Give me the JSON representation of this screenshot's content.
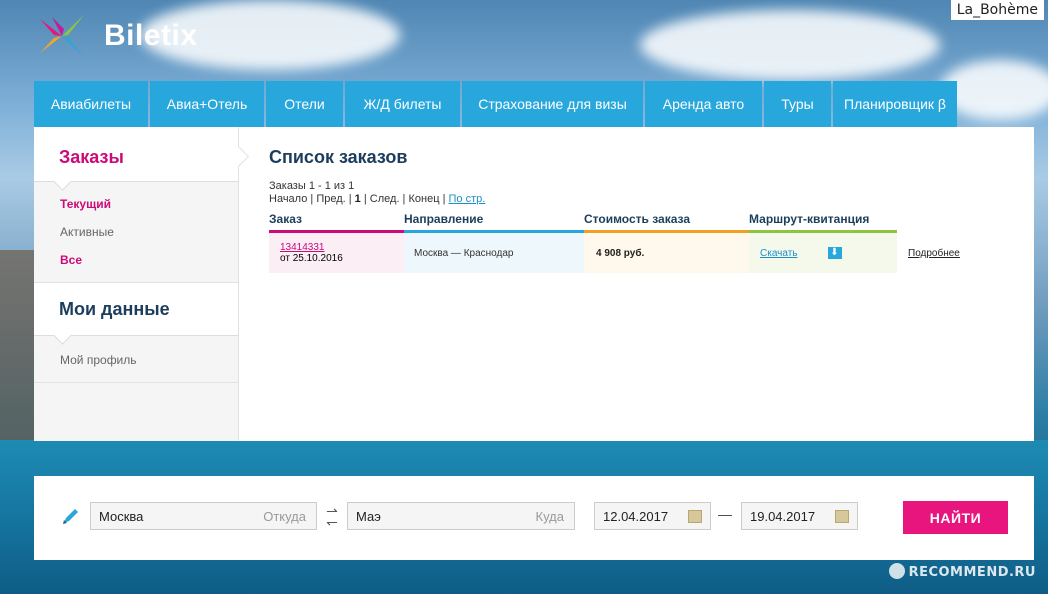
{
  "watermarks": {
    "user": "La_Bohème",
    "site": "RECOMMEND.RU"
  },
  "logo": {
    "text": "Biletix"
  },
  "nav": [
    {
      "label": "Авиабилеты"
    },
    {
      "label": "Авиа+Отель"
    },
    {
      "label": "Отели"
    },
    {
      "label": "Ж/Д билеты"
    },
    {
      "label": "Страхование для визы"
    },
    {
      "label": "Аренда авто"
    },
    {
      "label": "Туры"
    },
    {
      "label": "Планировщик β"
    }
  ],
  "sidebar": {
    "orders_title": "Заказы",
    "orders_links": [
      "Текущий",
      "Активные",
      "Все"
    ],
    "mydata_title": "Мои данные",
    "profile_link": "Мой профиль"
  },
  "content": {
    "title": "Список заказов",
    "pager_summary": "Заказы 1 - 1 из 1",
    "pager": {
      "start": "Начало",
      "prev": "Пред.",
      "current": "1",
      "next": "След.",
      "end": "Конец",
      "per_page": "По стр."
    },
    "columns": [
      "Заказ",
      "Направление",
      "Стоимость заказа",
      "Маршрут-квитанция"
    ],
    "rows": [
      {
        "order_id": "13414331",
        "order_date": "от 25.10.2016",
        "route": "Москва — Краснодар",
        "price": "4 908 руб.",
        "download": "Скачать",
        "details": "Подробнее"
      }
    ]
  },
  "search": {
    "from_value": "Москва",
    "from_placeholder": "Откуда",
    "to_value": "Маэ",
    "to_placeholder": "Куда",
    "date_from": "12.04.2017",
    "date_to": "19.04.2017",
    "date_sep": "—",
    "find_label": "НАЙТИ"
  },
  "colors": {
    "accent_blue": "#28a7dd",
    "accent_pink": "#e8157f",
    "brand_magenta": "#cc0a79"
  }
}
